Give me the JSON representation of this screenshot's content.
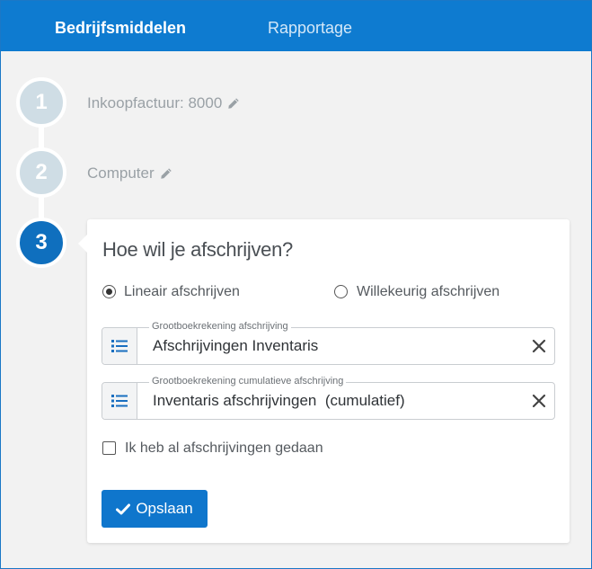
{
  "nav": {
    "tabs": [
      {
        "label": "Bedrijfsmiddelen",
        "active": true
      },
      {
        "label": "Rapportage",
        "active": false
      }
    ]
  },
  "steps": [
    {
      "number": "1",
      "label": "Inkoopfactuur: 8000",
      "editable": true,
      "icon": "pencil-icon"
    },
    {
      "number": "2",
      "label": "Computer",
      "editable": true,
      "icon": "pencil-icon"
    },
    {
      "number": "3",
      "label": "",
      "active": true
    }
  ],
  "card": {
    "title": "Hoe wil je afschrijven?",
    "radios": [
      {
        "label": "Lineair afschrijven",
        "checked": true
      },
      {
        "label": "Willekeurig afschrijven",
        "checked": false
      }
    ],
    "fields": [
      {
        "legend": "Grootboekrekening afschrijving",
        "value": "Afschrijvingen Inventaris",
        "icon": "list-icon"
      },
      {
        "legend": "Grootboekrekening cumulatieve afschrijving",
        "value": "Inventaris afschrijvingen  (cumulatief)",
        "icon": "list-icon"
      }
    ],
    "checkbox": {
      "label": "Ik heb al afschrijvingen gedaan",
      "checked": false
    },
    "save_label": "Opslaan"
  },
  "colors": {
    "accent": "#0e7bd0",
    "step_inactive": "#cfdde5",
    "step_active": "#0f6fbe"
  }
}
